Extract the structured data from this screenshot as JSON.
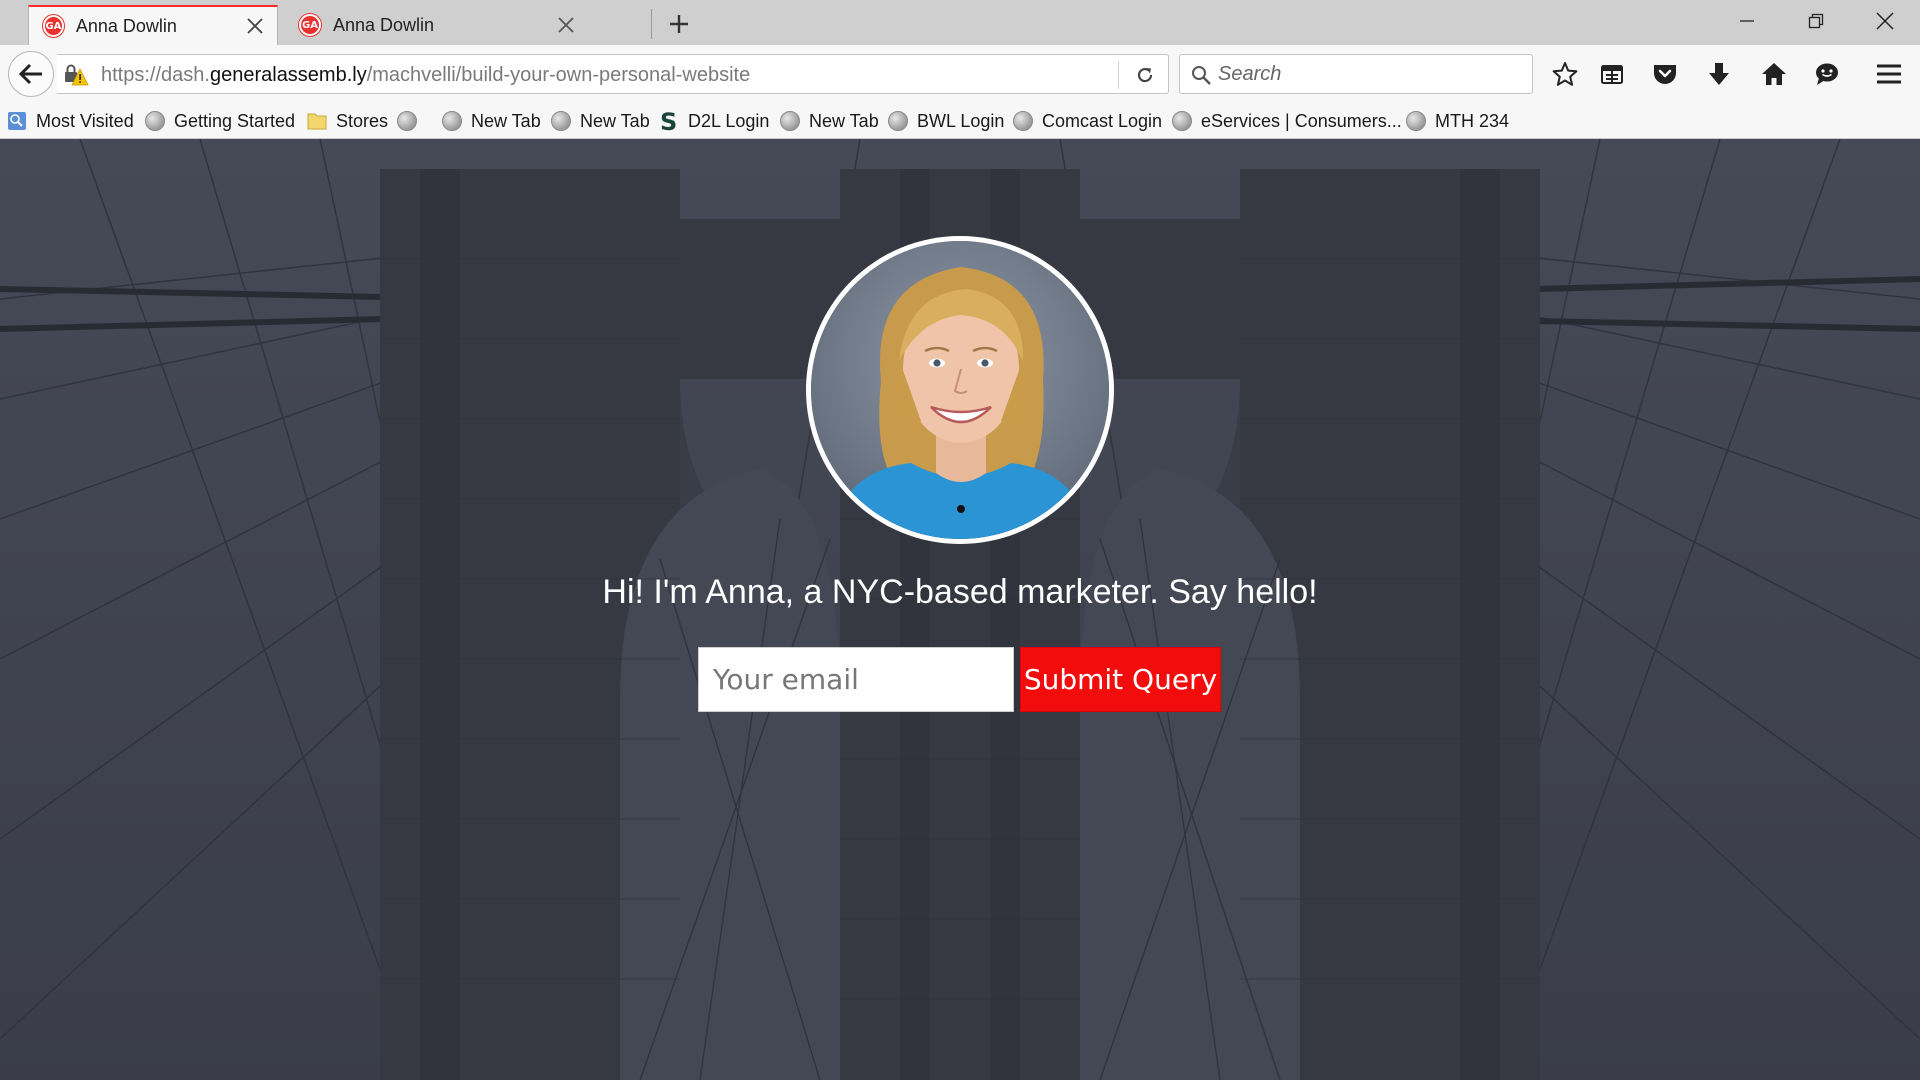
{
  "browser": {
    "tabs": [
      {
        "label": "Anna Dowlin",
        "favicon": "GA",
        "active": true
      },
      {
        "label": "Anna Dowlin",
        "favicon": "GA",
        "active": false
      }
    ],
    "url": {
      "prefix": "https://dash.",
      "domain": "generalassemb.ly",
      "path": "/machvelli/build-your-own-personal-website"
    },
    "search_placeholder": "Search",
    "bookmarks": [
      {
        "label": "Most Visited",
        "icon": "most-visited-icon"
      },
      {
        "label": "Getting Started",
        "icon": "globe-icon"
      },
      {
        "label": "Stores",
        "icon": "folder-icon"
      },
      {
        "label": "",
        "icon": "globe-icon"
      },
      {
        "label": "New Tab",
        "icon": "globe-icon"
      },
      {
        "label": "New Tab",
        "icon": "globe-icon"
      },
      {
        "label": "D2L Login",
        "icon": "spartan-s-icon"
      },
      {
        "label": "New Tab",
        "icon": "globe-icon"
      },
      {
        "label": "BWL Login",
        "icon": "globe-icon"
      },
      {
        "label": "Comcast Login",
        "icon": "globe-icon"
      },
      {
        "label": "eServices | Consumers...",
        "icon": "globe-icon"
      },
      {
        "label": "MTH 234",
        "icon": "globe-icon"
      }
    ]
  },
  "page": {
    "headline": "Hi! I'm Anna, a NYC-based marketer. Say hello!",
    "email_placeholder": "Your email",
    "submit_label": "Submit Query"
  },
  "colors": {
    "tab_accent": "#ff2a2a",
    "favicon": "#e8322f",
    "submit_button": "#f20c0c",
    "hero_overlay": "#3d404b",
    "shirt": "#2b94d4"
  }
}
